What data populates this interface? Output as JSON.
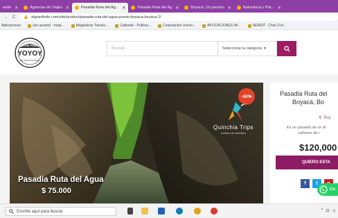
{
  "browser": {
    "tabs": [
      {
        "label": "aetto",
        "active": false
      },
      {
        "label": "Agencias de Viajes",
        "active": false
      },
      {
        "label": "Pasadia Ruta del Ag...",
        "active": true
      },
      {
        "label": "Pasadia Ruta del Ag",
        "active": false
      },
      {
        "label": "Boyacá, Un paraíso",
        "active": false
      },
      {
        "label": "Naturaleza y Pat...",
        "active": false
      }
    ],
    "url": "elgranfinde.com/site/product/pasadia-ruta-del-agua-puerto-boyaca-boyaca-2/",
    "bookmarks": [
      "Aplicaciones",
      "(sin asunto) - mapl...",
      "Magdalena Travels...",
      "Cabinete - Publica...",
      "Corporación Univer...",
      "APLICACIONES WI...",
      "SENDIT - Chat | Fre..."
    ]
  },
  "site": {
    "logo": {
      "line1": "GRAN FINDE",
      "line2": "YOYOY",
      "line3": "SÉ PARTE DE ESTO"
    },
    "search": {
      "placeholder": "Buscar...",
      "category": "Seleccione la categoría"
    },
    "hero": {
      "discount": "-50%",
      "brand_name": "Quinchia Trips",
      "brand_sub": "turismo de aventura",
      "caption_title": "Pasadía Ruta del Agua",
      "caption_price": "$ 75.000"
    },
    "product": {
      "title_line1": "Pasadia Ruta del",
      "title_line2": "Boyacá, Bo",
      "location": "Boy",
      "desc_line1": "Es un pasadía de un dí",
      "desc_line2": "cañones de r",
      "price": "$120,000",
      "cta": "QUIERO ESTA"
    },
    "whatsapp_label": "Co"
  },
  "taskbar": {
    "search_placeholder": "Escribe aquí para buscar"
  },
  "colors": {
    "accent": "#9c1b63",
    "tabbar": "#8e3fa6",
    "discount": "#e4432b",
    "whatsapp": "#25d366"
  }
}
